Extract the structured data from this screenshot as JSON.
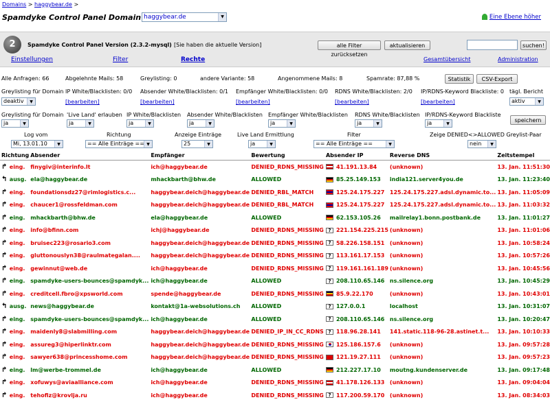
{
  "breadcrumb": {
    "root": "Domains",
    "sep1": ">",
    "current": "haggybear.de",
    "sep2": ">"
  },
  "page_title": "Spamdyke Control Panel Domain",
  "domain_select": "haggybear.de",
  "level_up": "Eine Ebene höher",
  "logo_glyph": "2",
  "version": "Spamdyke Control Panel Version (2.3.2-mysql)",
  "version_note": "[Sie haben die aktuelle Version]",
  "buttons": {
    "reset": "alle Filter zurücksetzen",
    "refresh": "aktualisieren",
    "search": "suchen!",
    "stats": "Statistik",
    "csv": "CSV-Export",
    "save": "speichern"
  },
  "tabs": [
    "Einstellungen",
    "Filter",
    "Rechte"
  ],
  "right_tabs": [
    "Gesamtübersicht",
    "Administration"
  ],
  "stats": {
    "all": "Alle Anfragen: 66",
    "rejected": "Abgelehnte Mails: 58",
    "greylisting": "Greylisting: 0",
    "other": "andere Variante: 58",
    "accepted": "Angenommene Mails: 8",
    "spamrate": "Spamrate: 87,88 %"
  },
  "settings_row1": {
    "greylisting": {
      "label": "Greylisting für Domain",
      "value": "deaktiv"
    },
    "ip": {
      "label": "IP White/Blacklisten: 0/0",
      "link": "[bearbeiten]"
    },
    "sender": {
      "label": "Absender White/Blacklisten: 0/1",
      "link": "[bearbeiten]"
    },
    "recipient": {
      "label": "Empfänger White/Blacklisten: 0/0",
      "link": "[bearbeiten]"
    },
    "rdns": {
      "label": "RDNS White/Blacklisten: 2/0",
      "link": "[bearbeiten]"
    },
    "iprdns": {
      "label": "IP/RDNS-Keyword Blackliste: 0",
      "link": "[bearbeiten]"
    },
    "daily": {
      "label": "tägl. Bericht",
      "value": "aktiv"
    }
  },
  "settings_row2": {
    "greylisting": {
      "label": "Greylisting für Domain",
      "value": "ja"
    },
    "liveland": {
      "label": "'Live Land' erlauben",
      "value": "ja"
    },
    "ip": {
      "label": "IP White/Blacklisten",
      "value": "ja"
    },
    "sender": {
      "label": "Absender White/Blacklisten",
      "value": "ja"
    },
    "recipient": {
      "label": "Empfänger White/Blacklisten",
      "value": "ja"
    },
    "rdns": {
      "label": "RDNS White/Blacklisten",
      "value": "ja"
    },
    "iprdns": {
      "label": "IP/RDNS-Keyword Blackliste",
      "value": "ja"
    }
  },
  "filters": {
    "log": {
      "label": "Log vom",
      "value": "Mi, 13.01.10"
    },
    "direction": {
      "label": "Richtung",
      "value": "== Alle Einträge =="
    },
    "count": {
      "label": "Anzeige Einträge",
      "value": "25"
    },
    "liveland": {
      "label": "Live Land Ermittlung",
      "value": "ja"
    },
    "filter": {
      "label": "Filter",
      "value": "== Alle Einträge =="
    },
    "denied": {
      "label": "Zeige DENIED<>ALLOWED Greylist-Paar",
      "value": "nein"
    }
  },
  "table": {
    "headers": [
      "Richtung",
      "Absender",
      "Empfänger",
      "Bewertung",
      "Absender IP",
      "Reverse DNS",
      "Zeitstempel"
    ],
    "rows": [
      {
        "arrow": "↱",
        "dir": "eing.",
        "from": "finygiv@interinfo.lt",
        "to": "ich@haggybear.de",
        "rating": "DENIED_RDNS_MISSING",
        "flag": [
          "#c00",
          "#fff",
          "#c00"
        ],
        "ip": "41.191.13.84",
        "rdns": "(unknown)",
        "time": "13. Jan. 11:51:30",
        "ok": false
      },
      {
        "arrow": "↰",
        "dir": "ausg.",
        "from": "ela@haggybear.de",
        "to": "mhackbarth@bhw.de",
        "rating": "ALLOWED",
        "flag": [
          "#000",
          "#d00",
          "#fc0"
        ],
        "ip": "85.25.149.153",
        "rdns": "india121.server4you.de",
        "time": "13. Jan. 11:23:40",
        "ok": true
      },
      {
        "arrow": "↱",
        "dir": "eing.",
        "from": "foundationsdz27@rimlogistics.c...",
        "to": "haggybear.deich@haggybear.de",
        "rating": "DENIED_RBL_MATCH",
        "flag": [
          "#d00",
          "#00a",
          "#d00"
        ],
        "ip": "125.24.175.227",
        "rdns": "125.24.175.227.adsl.dynamic.to...",
        "time": "13. Jan. 11:05:09",
        "ok": false
      },
      {
        "arrow": "↱",
        "dir": "eing.",
        "from": "chaucer1@rossfeldman.com",
        "to": "haggybear.deich@haggybear.de",
        "rating": "DENIED_RBL_MATCH",
        "flag": [
          "#d00",
          "#00a",
          "#d00"
        ],
        "ip": "125.24.175.227",
        "rdns": "125.24.175.227.adsl.dynamic.to...",
        "time": "13. Jan. 11:03:32",
        "ok": false
      },
      {
        "arrow": "↱",
        "dir": "eing.",
        "from": "mhackbarth@bhw.de",
        "to": "ela@haggybear.de",
        "rating": "ALLOWED",
        "flag": [
          "#000",
          "#d00",
          "#fc0"
        ],
        "ip": "62.153.105.26",
        "rdns": "mailrelay1.bonn.postbank.de",
        "time": "13. Jan. 11:01:27",
        "ok": true
      },
      {
        "arrow": "↱",
        "dir": "eing.",
        "from": "info@bfinn.com",
        "to": "ichj@haggybear.de",
        "rating": "DENIED_RDNS_MISSING",
        "flag": "?",
        "ip": "221.154.225.215",
        "rdns": "(unknown)",
        "time": "13. Jan. 11:01:06",
        "ok": false
      },
      {
        "arrow": "↱",
        "dir": "eing.",
        "from": "bruisec223@rosario3.com",
        "to": "haggybear.deich@haggybear.de",
        "rating": "DENIED_RDNS_MISSING",
        "flag": "?",
        "ip": "58.226.158.151",
        "rdns": "(unknown)",
        "time": "13. Jan. 10:58:24",
        "ok": false
      },
      {
        "arrow": "↱",
        "dir": "eing.",
        "from": "gluttonouslyn38@raulmategalan....",
        "to": "haggybear.deich@haggybear.de",
        "rating": "DENIED_RDNS_MISSING",
        "flag": "?",
        "ip": "113.161.17.153",
        "rdns": "(unknown)",
        "time": "13. Jan. 10:57:26",
        "ok": false
      },
      {
        "arrow": "↱",
        "dir": "eing.",
        "from": "gewinnut@web.de",
        "to": "ich@haggybear.de",
        "rating": "DENIED_RDNS_MISSING",
        "flag": "?",
        "ip": "119.161.161.189",
        "rdns": "(unknown)",
        "time": "13. Jan. 10:45:56",
        "ok": false
      },
      {
        "arrow": "↱",
        "dir": "eing.",
        "from": "spamdyke-users-bounces@spamdyk...",
        "to": "ich@haggybear.de",
        "rating": "ALLOWED",
        "flag": "?",
        "ip": "208.110.65.146",
        "rdns": "ns.silence.org",
        "time": "13. Jan. 10:45:29",
        "ok": true
      },
      {
        "arrow": "↱",
        "dir": "eing.",
        "from": "creditcell.fbro@xpsworld.com",
        "to": "spende@haggybear.de",
        "rating": "DENIED_RDNS_MISSING",
        "flag": [
          "#003",
          "#fc0",
          "#c00"
        ],
        "ip": "85.9.22.170",
        "rdns": "(unknown)",
        "time": "13. Jan. 10:43:01",
        "ok": false
      },
      {
        "arrow": "↰",
        "dir": "ausg.",
        "from": "news@haggybear.de",
        "to": "kontakt@1a-websolutions.ch",
        "rating": "ALLOWED",
        "flag": "?",
        "ip": "127.0.0.1",
        "rdns": "localhost",
        "time": "13. Jan. 10:31:07",
        "ok": true
      },
      {
        "arrow": "↱",
        "dir": "eing.",
        "from": "spamdyke-users-bounces@spamdyk...",
        "to": "ich@haggybear.de",
        "rating": "ALLOWED",
        "flag": "?",
        "ip": "208.110.65.146",
        "rdns": "ns.silence.org",
        "time": "13. Jan. 10:20:47",
        "ok": true
      },
      {
        "arrow": "↱",
        "dir": "eing.",
        "from": "maidenly8@slabmilling.com",
        "to": "haggybear.deich@haggybear.de",
        "rating": "DENIED_IP_IN_CC_RDNS",
        "flag": "?",
        "ip": "118.96.28.141",
        "rdns": "141.static.118-96-28.astinet.t...",
        "time": "13. Jan. 10:10:33",
        "ok": false
      },
      {
        "arrow": "↱",
        "dir": "eing.",
        "from": "assureg3@hiperlinktr.com",
        "to": "haggybear.deich@haggybear.de",
        "rating": "DENIED_RDNS_MISSING",
        "flag": "kr",
        "ip": "125.186.157.6",
        "rdns": "(unknown)",
        "time": "13. Jan. 09:57:28",
        "ok": false
      },
      {
        "arrow": "↱",
        "dir": "eing.",
        "from": "sawyer638@princesshome.com",
        "to": "haggybear.deich@haggybear.de",
        "rating": "DENIED_RDNS_MISSING",
        "flag": [
          "#d00",
          "#d00",
          "#d00"
        ],
        "ip": "121.19.27.111",
        "rdns": "(unknown)",
        "time": "13. Jan. 09:57:23",
        "ok": false
      },
      {
        "arrow": "↱",
        "dir": "eing.",
        "from": "lm@werbe-trommel.de",
        "to": "ich@haggybear.de",
        "rating": "ALLOWED",
        "flag": [
          "#000",
          "#d00",
          "#fc0"
        ],
        "ip": "212.227.17.10",
        "rdns": "moutng.kundenserver.de",
        "time": "13. Jan. 09:17:48",
        "ok": true
      },
      {
        "arrow": "↱",
        "dir": "eing.",
        "from": "xofuwys@aviaalliance.com",
        "to": "ich@haggybear.de",
        "rating": "DENIED_RDNS_MISSING",
        "flag": [
          "#c00",
          "#fff",
          "#c00"
        ],
        "ip": "41.178.126.133",
        "rdns": "(unknown)",
        "time": "13. Jan. 09:04:04",
        "ok": false
      },
      {
        "arrow": "↱",
        "dir": "eing.",
        "from": "tehofiz@krovlja.ru",
        "to": "ich@haggybear.de",
        "rating": "DENIED_RDNS_MISSING",
        "flag": "?",
        "ip": "117.200.59.170",
        "rdns": "(unknown)",
        "time": "13. Jan. 08:34:03",
        "ok": false
      }
    ]
  },
  "colors": {
    "denied": "#e00000",
    "allowed": "#006600",
    "link": "#0000cc"
  }
}
